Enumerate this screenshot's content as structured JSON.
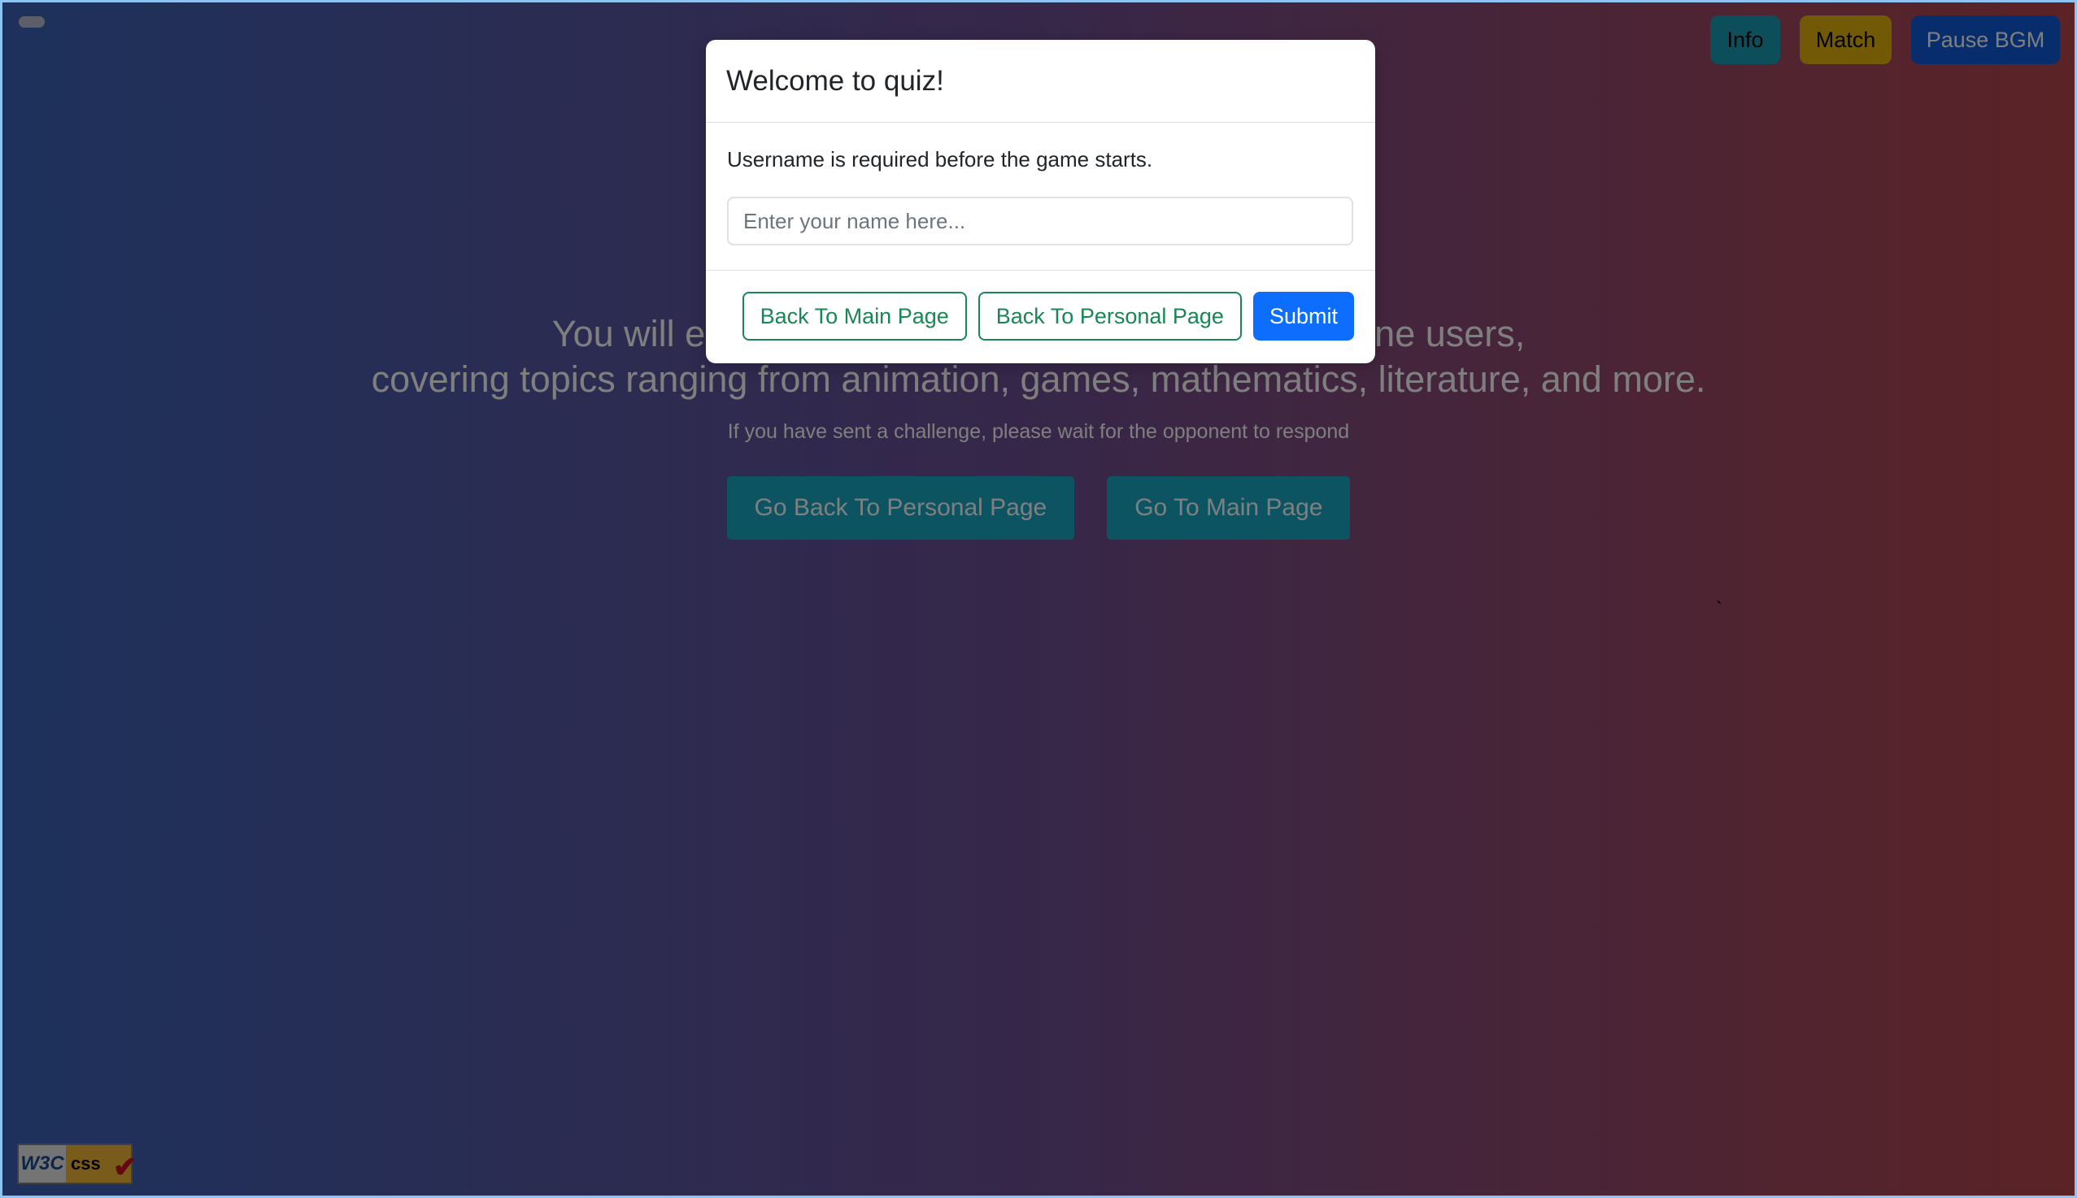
{
  "topbar": {
    "info_label": "Info",
    "match_label": "Match",
    "bgm_label": "Pause BGM"
  },
  "hero": {
    "line1": "You will engage in quiz competitions with other online users,",
    "line2": "covering topics ranging from animation, games, mathematics, literature, and more.",
    "subtitle": "If you have sent a challenge, please wait for the opponent to respond",
    "back_personal_label": "Go Back To Personal Page",
    "main_label": "Go To Main Page"
  },
  "modal": {
    "title": "Welcome to quiz!",
    "message": "Username is required before the game starts.",
    "input_placeholder": "Enter your name here...",
    "input_value": "",
    "back_main_label": "Back To Main Page",
    "back_personal_label": "Back To Personal Page",
    "submit_label": "Submit"
  },
  "badge": {
    "left_text": "W3C",
    "right_text": "css",
    "check": "✔"
  },
  "colors": {
    "gradient_left": "#3b63b8",
    "gradient_right": "#b7464c",
    "info": "#1b9db6",
    "match": "#e3b30b",
    "bgm": "#0f5bd8",
    "submit": "#0d6efd",
    "outline": "#198754"
  }
}
